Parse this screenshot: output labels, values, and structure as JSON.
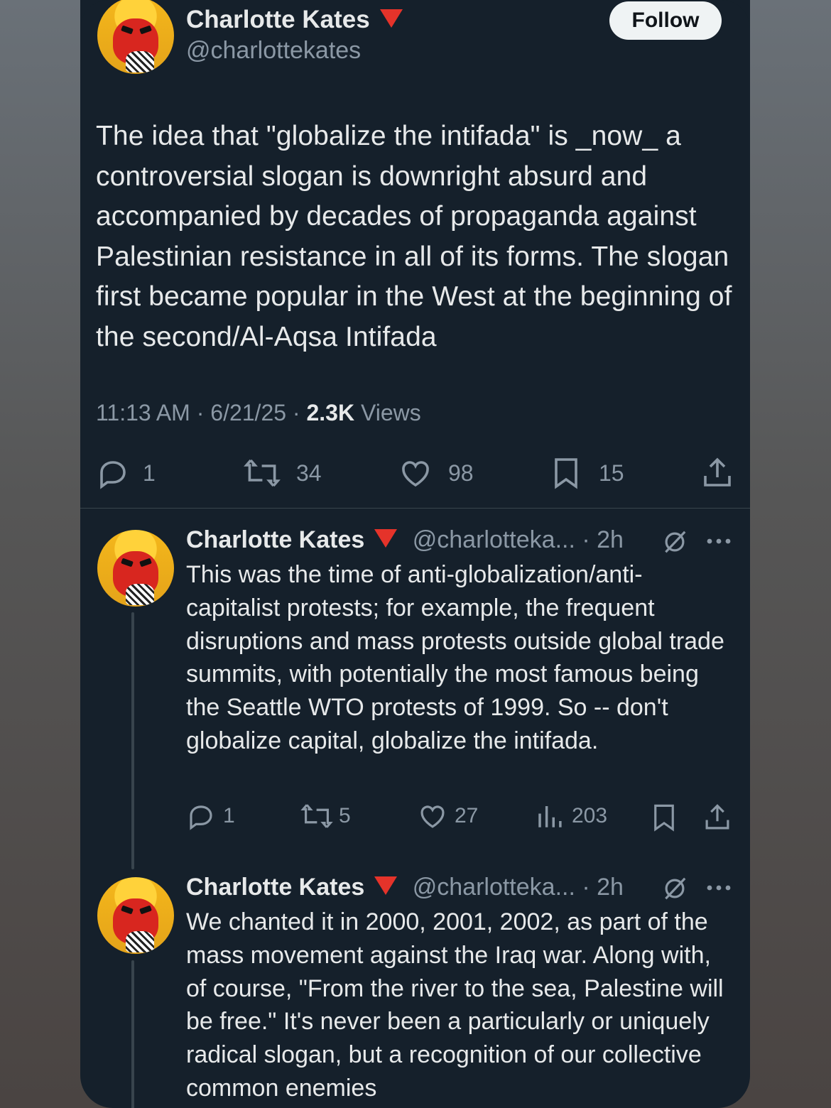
{
  "main_tweet": {
    "author_name": "Charlotte Kates",
    "handle": "@charlottekates",
    "follow_label": "Follow",
    "text": "The idea that \"globalize the intifada\" is _now_ a controversial slogan is downright absurd and accompanied by decades of propaganda against Palestinian resistance in all of its forms. The slogan first became popular in the West at the beginning of the second/Al-Aqsa Intifada",
    "time": "11:13 AM",
    "date": "6/21/25",
    "views_count": "2.3K",
    "views_label": "Views",
    "replies": "1",
    "reposts": "34",
    "likes": "98",
    "bookmarks": "15"
  },
  "replies": [
    {
      "author_name": "Charlotte Kates",
      "handle": "@charlotteka...",
      "age": "2h",
      "text": "This was the time of anti-globalization/anti-capitalist protests; for example, the frequent disruptions and mass protests outside global trade summits, with potentially the most famous being the Seattle WTO protests of 1999. So -- don't globalize capital, globalize the intifada.",
      "replies": "1",
      "reposts": "5",
      "likes": "27",
      "views": "203"
    },
    {
      "author_name": "Charlotte Kates",
      "handle": "@charlotteka...",
      "age": "2h",
      "text": "We chanted it in 2000, 2001, 2002, as part of the mass movement against the Iraq war. Along with, of course, \"From the river to the sea, Palestine will be free.\" It's never been a particularly or uniquely radical slogan, but a recognition of our collective common enemies"
    }
  ],
  "colors": {
    "background": "#15202b",
    "text": "#e7e9ea",
    "muted": "#8b98a5",
    "triangle": "#e5332a"
  },
  "icons": [
    "reply-icon",
    "repost-icon",
    "like-icon",
    "bookmark-icon",
    "share-icon",
    "views-icon",
    "grok-icon",
    "more-icon"
  ]
}
